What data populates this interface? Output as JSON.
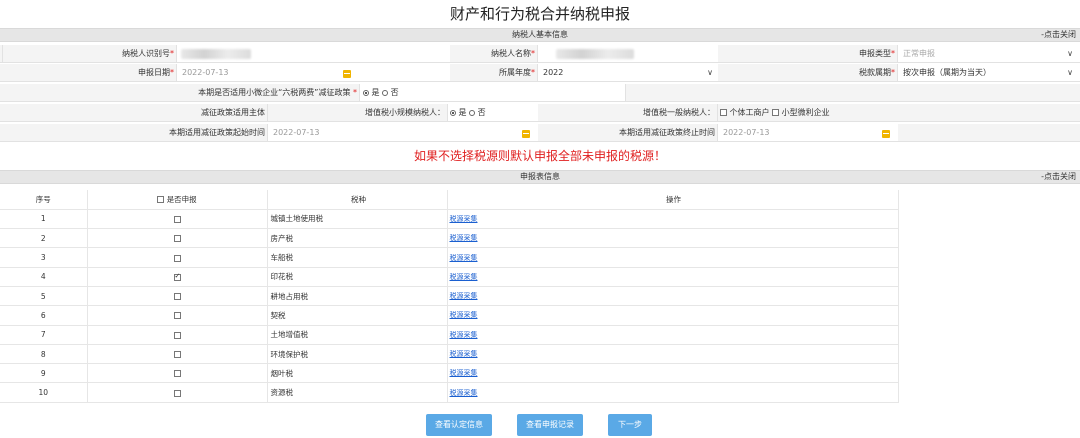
{
  "title": "财产和行为税合并纳税申报",
  "basic_section": {
    "title": "纳税人基本信息",
    "close": "-点击关闭"
  },
  "fields": {
    "taxpayer_id_label": "纳税人识别号",
    "taxpayer_name_label": "纳税人名称",
    "declare_type_label": "申报类型",
    "declare_type_value": "正常申报",
    "declare_date_label": "申报日期",
    "declare_date_value": "2022-07-13",
    "year_label": "所属年度",
    "year_value": "2022",
    "period_label": "税款属期",
    "period_value": "按次申报（属期为当天）",
    "small_biz_question": "本期是否适用小微企业“六税两费”减征政策",
    "yes": "是",
    "no": "否",
    "subject_label": "减征政策适用主体",
    "vat_small_label": "增值税小规模纳税人：",
    "vat_general_label": "增值税一般纳税人：",
    "individual_label": "个体工商户",
    "micro_label": "小型微利企业",
    "start_label": "本期适用减征政策起始时间",
    "start_value": "2022-07-13",
    "end_label": "本期适用减征政策终止时间",
    "end_value": "2022-07-13"
  },
  "notice": "如果不选择税源则默认申报全部未申报的税源！",
  "form_section": {
    "title": "申报表信息",
    "close": "-点击关闭"
  },
  "table": {
    "headers": {
      "no": "序号",
      "declare": "是否申报",
      "tax": "税种",
      "op": "操作"
    },
    "rows": [
      {
        "no": "1",
        "tax": "城镇土地使用税",
        "op": "税源采集",
        "checked": false
      },
      {
        "no": "2",
        "tax": "房产税",
        "op": "税源采集",
        "checked": false
      },
      {
        "no": "3",
        "tax": "车船税",
        "op": "税源采集",
        "checked": false
      },
      {
        "no": "4",
        "tax": "印花税",
        "op": "税源采集",
        "checked": true
      },
      {
        "no": "5",
        "tax": "耕地占用税",
        "op": "税源采集",
        "checked": false
      },
      {
        "no": "6",
        "tax": "契税",
        "op": "税源采集",
        "checked": false
      },
      {
        "no": "7",
        "tax": "土地增值税",
        "op": "税源采集",
        "checked": false
      },
      {
        "no": "8",
        "tax": "环境保护税",
        "op": "税源采集",
        "checked": false
      },
      {
        "no": "9",
        "tax": "烟叶税",
        "op": "税源采集",
        "checked": false
      },
      {
        "no": "10",
        "tax": "资源税",
        "op": "税源采集",
        "checked": false
      }
    ]
  },
  "buttons": {
    "auth": "查看认定信息",
    "record": "查看申报记录",
    "next": "下一步"
  }
}
